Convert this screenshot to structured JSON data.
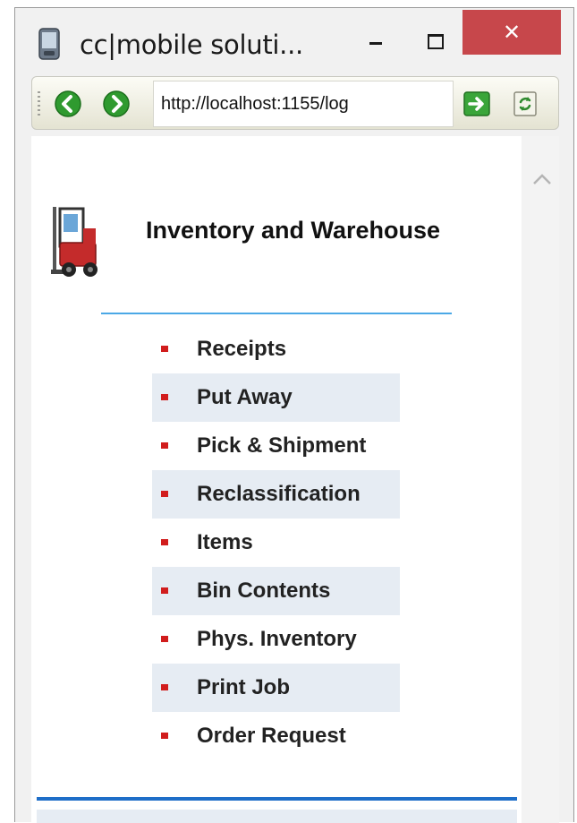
{
  "window": {
    "title": "cc|mobile soluti...",
    "close_label": "✕"
  },
  "toolbar": {
    "url": "http://localhost:1155/log"
  },
  "page": {
    "title": "Inventory and Warehouse"
  },
  "menu": {
    "items": [
      {
        "label": "Receipts"
      },
      {
        "label": "Put Away"
      },
      {
        "label": "Pick & Shipment"
      },
      {
        "label": "Reclassification"
      },
      {
        "label": "Items"
      },
      {
        "label": "Bin Contents"
      },
      {
        "label": "Phys. Inventory"
      },
      {
        "label": "Print Job"
      },
      {
        "label": "Order Request"
      }
    ]
  },
  "colors": {
    "bullet": "#d11d1d",
    "row_alt": "#e6ecf3",
    "rule_top": "#4ba8e6",
    "rule_bottom": "#1e6ec8",
    "close_button": "#c7474b"
  }
}
